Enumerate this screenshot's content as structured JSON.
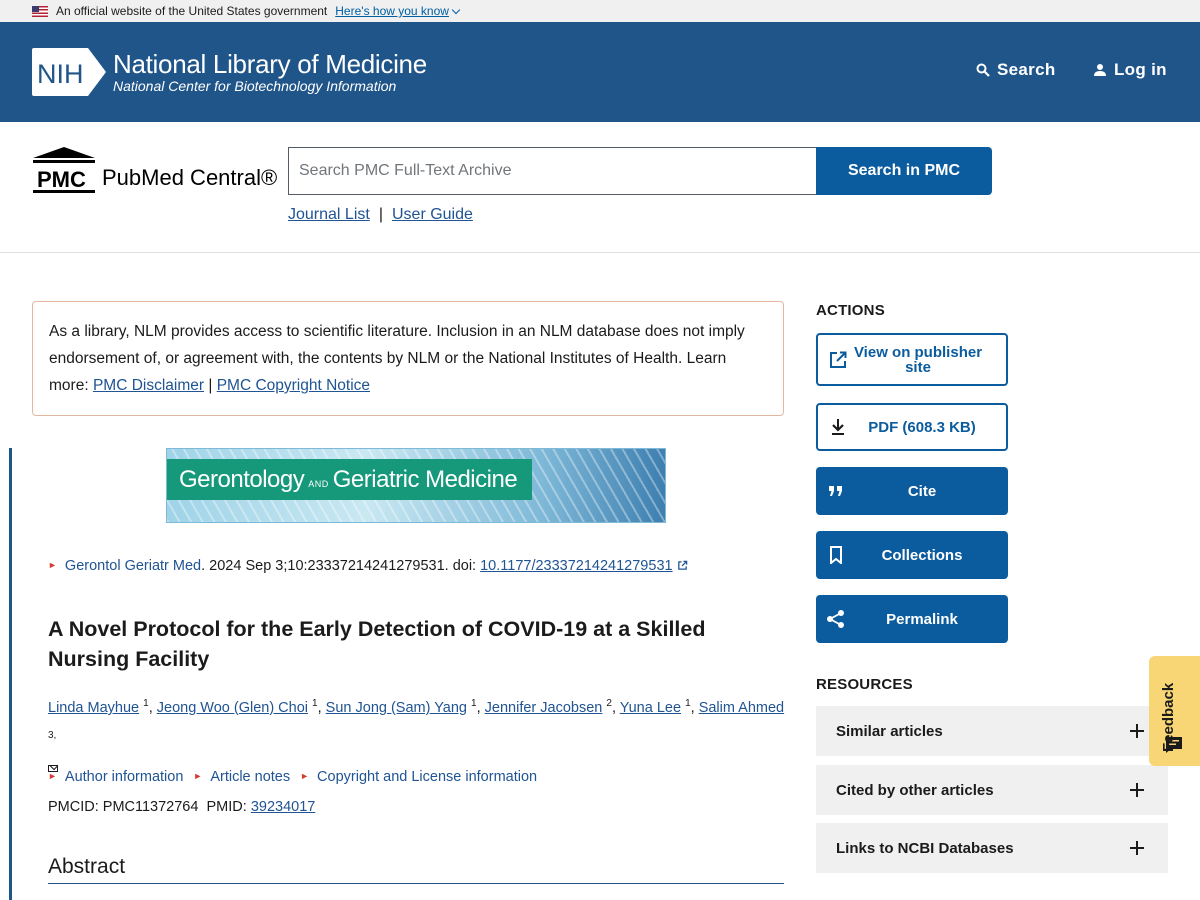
{
  "gov_banner": {
    "text": "An official website of the United States government",
    "link": "Here's how you know"
  },
  "nlm_header": {
    "logo_text": "NIH",
    "title": "National Library of Medicine",
    "subtitle": "National Center for Biotechnology Information",
    "search_label": "Search",
    "login_label": "Log in"
  },
  "pmc": {
    "logo_abbr": "PMC",
    "logo_full": "PubMed Central®",
    "search_placeholder": "Search PMC Full-Text Archive",
    "search_button": "Search in PMC",
    "journal_list": "Journal List",
    "separator": "|",
    "user_guide": "User Guide"
  },
  "disclaimer": {
    "text": "As a library, NLM provides access to scientific literature. Inclusion in an NLM database does not imply endorsement of, or agreement with, the contents by NLM or the National Institutes of Health.",
    "learn_more": "Learn more:",
    "link1": "PMC Disclaimer",
    "sep": "|",
    "link2": "PMC Copyright Notice"
  },
  "journal_banner": {
    "part1": "Gerontology",
    "and": "AND",
    "part2": "Geriatric Medicine"
  },
  "citation": {
    "journal": "Gerontol Geriatr Med",
    "details": ". 2024 Sep 3;10:23337214241279531. doi: ",
    "doi": "10.1177/23337214241279531"
  },
  "article": {
    "title": "A Novel Protocol for the Early Detection of COVID-19 at a Skilled Nursing Facility",
    "authors": [
      {
        "name": "Linda Mayhue",
        "aff": "1"
      },
      {
        "name": "Jeong Woo (Glen) Choi",
        "aff": "1"
      },
      {
        "name": "Sun Jong (Sam) Yang",
        "aff": "1"
      },
      {
        "name": "Jennifer Jacobsen",
        "aff": "2"
      },
      {
        "name": "Yuna Lee",
        "aff": "1"
      },
      {
        "name": "Salim Ahmed",
        "aff": "3,"
      }
    ],
    "info_links": [
      "Author information",
      "Article notes",
      "Copyright and License information"
    ],
    "pmcid_label": "PMCID: PMC11372764",
    "pmid_label": "PMID:",
    "pmid": "39234017",
    "abstract_heading": "Abstract"
  },
  "sidebar": {
    "actions_heading": "ACTIONS",
    "actions": [
      {
        "label": "View on publisher site",
        "icon": "external-link-icon"
      },
      {
        "label": "PDF (608.3 KB)",
        "icon": "download-icon"
      },
      {
        "label": "Cite",
        "icon": "quote-icon"
      },
      {
        "label": "Collections",
        "icon": "bookmark-icon"
      },
      {
        "label": "Permalink",
        "icon": "share-icon"
      }
    ],
    "resources_heading": "RESOURCES",
    "resources": [
      "Similar articles",
      "Cited by other articles",
      "Links to NCBI Databases"
    ]
  },
  "feedback": "Feedback",
  "colors": {
    "header_blue": "#20558a",
    "button_blue": "#0b5c9e",
    "link_blue": "#205493",
    "feedback_yellow": "#f9d675",
    "journal_green": "#16987a"
  }
}
